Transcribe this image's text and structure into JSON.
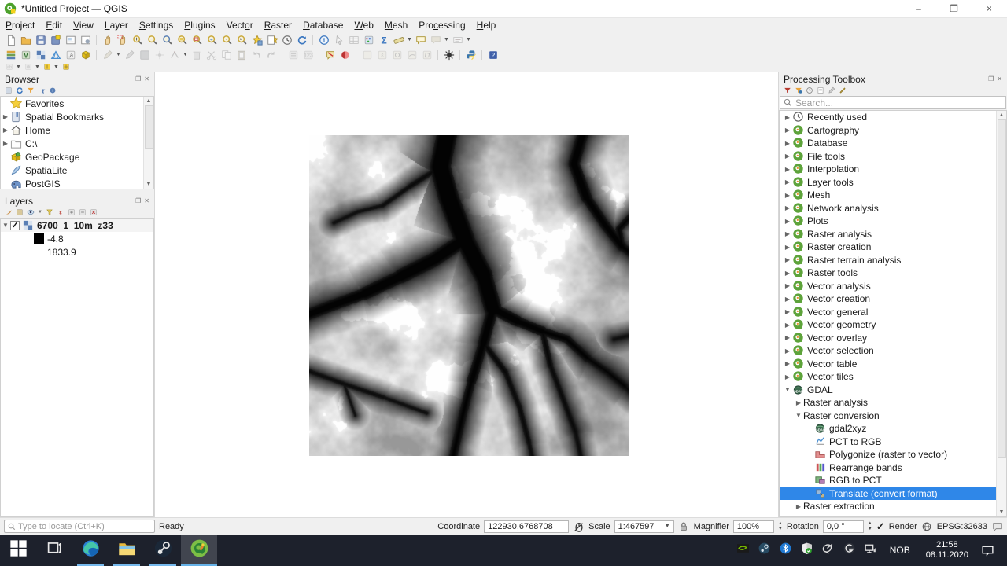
{
  "window": {
    "title": "*Untitled Project — QGIS",
    "minimize": "–",
    "restore": "❐",
    "close": "×"
  },
  "menu": {
    "items": [
      {
        "label": "Project",
        "u": 0
      },
      {
        "label": "Edit",
        "u": 0
      },
      {
        "label": "View",
        "u": 0
      },
      {
        "label": "Layer",
        "u": 0
      },
      {
        "label": "Settings",
        "u": 0
      },
      {
        "label": "Plugins",
        "u": 0
      },
      {
        "label": "Vector",
        "u": 4
      },
      {
        "label": "Raster",
        "u": 0
      },
      {
        "label": "Database",
        "u": 0
      },
      {
        "label": "Web",
        "u": 0
      },
      {
        "label": "Mesh",
        "u": 0
      },
      {
        "label": "Processing",
        "u": 3
      },
      {
        "label": "Help",
        "u": 0
      }
    ]
  },
  "toolbars": {
    "row1": [
      {
        "n": "new-project",
        "k": "doc"
      },
      {
        "n": "open-project",
        "k": "folder"
      },
      {
        "n": "save-project",
        "k": "disk"
      },
      {
        "n": "save-project-as",
        "k": "disklock"
      },
      {
        "n": "new-print-layout",
        "k": "layout"
      },
      {
        "n": "layout-manager",
        "k": "layoutmgr"
      },
      {
        "sep": true
      },
      {
        "n": "pan-map",
        "k": "hand"
      },
      {
        "n": "pan-to-selection",
        "k": "handsel"
      },
      {
        "n": "zoom-in",
        "k": "mag",
        "t": "+"
      },
      {
        "n": "zoom-out",
        "k": "mag",
        "t": "−"
      },
      {
        "n": "zoom-native",
        "k": "magblue"
      },
      {
        "n": "zoom-full",
        "k": "magfull"
      },
      {
        "n": "zoom-to-selection",
        "k": "magsel"
      },
      {
        "n": "zoom-to-layer",
        "k": "maglayer"
      },
      {
        "n": "zoom-last",
        "k": "magback"
      },
      {
        "n": "zoom-next",
        "k": "magfwd"
      },
      {
        "n": "new-bookmark",
        "k": "bookstar"
      },
      {
        "n": "show-bookmarks",
        "k": "bookshow"
      },
      {
        "n": "temporal-controller",
        "k": "clock"
      },
      {
        "n": "refresh-map",
        "k": "refresh"
      },
      {
        "sep": true
      },
      {
        "n": "identify-features",
        "k": "identify"
      },
      {
        "n": "select-features",
        "k": "cursorsel",
        "dis": true
      },
      {
        "n": "open-attribute-table",
        "k": "table",
        "dis": true
      },
      {
        "n": "field-calculator",
        "k": "abacus"
      },
      {
        "n": "statistical-summary",
        "k": "sigma"
      },
      {
        "n": "measure",
        "k": "ruler"
      },
      {
        "n": "measure-caret",
        "k": "caret"
      },
      {
        "n": "map-tips",
        "k": "bubble"
      },
      {
        "n": "new-annotation",
        "k": "bubbleyellow",
        "dis": true
      },
      {
        "n": "annotation-caret",
        "k": "caret"
      },
      {
        "n": "decorations",
        "k": "titlebox",
        "dis": true
      },
      {
        "n": "decorations-caret",
        "k": "caret"
      }
    ],
    "row2": [
      {
        "n": "data-source-manager",
        "k": "dsm"
      },
      {
        "n": "add-vector-layer",
        "k": "addvector"
      },
      {
        "n": "add-raster-layer",
        "k": "addraster"
      },
      {
        "n": "add-mesh-layer",
        "k": "addmesh"
      },
      {
        "n": "add-delimited-text",
        "k": "adddelim"
      },
      {
        "n": "new-geopackage-layer",
        "k": "newgpkg"
      },
      {
        "sep": true
      },
      {
        "n": "current-edits",
        "k": "editpen",
        "dis": true
      },
      {
        "n": "edits-caret",
        "k": "caret"
      },
      {
        "n": "toggle-editing",
        "k": "pencil",
        "dis": true
      },
      {
        "n": "save-layer-edits",
        "k": "diskedit",
        "dis": true
      },
      {
        "n": "add-feature",
        "k": "nodeadd",
        "dis": true
      },
      {
        "n": "vertex-tool",
        "k": "nodetool",
        "dis": true
      },
      {
        "n": "vertex-caret",
        "k": "caret"
      },
      {
        "n": "delete-selected",
        "k": "trash",
        "dis": true
      },
      {
        "n": "cut-features",
        "k": "scissors",
        "dis": true
      },
      {
        "n": "copy-features",
        "k": "copy",
        "dis": true
      },
      {
        "n": "paste-features",
        "k": "paste",
        "dis": true
      },
      {
        "n": "undo",
        "k": "undo",
        "dis": true
      },
      {
        "n": "redo",
        "k": "redo",
        "dis": true
      },
      {
        "sep": true
      },
      {
        "n": "select-by-form",
        "k": "formsel",
        "dis": true
      },
      {
        "n": "select-by-value",
        "k": "formsel2",
        "dis": true
      },
      {
        "sep": true
      },
      {
        "n": "deselect-all",
        "k": "deselect"
      },
      {
        "n": "invert-selection",
        "k": "invertsel"
      },
      {
        "sep": true
      },
      {
        "n": "select-all",
        "k": "selall",
        "dis": true
      },
      {
        "n": "select-by-expression",
        "k": "selexp",
        "dis": true
      },
      {
        "n": "select-by-radius",
        "k": "selrad",
        "dis": true
      },
      {
        "n": "select-freehand",
        "k": "selfree",
        "dis": true
      },
      {
        "n": "select-polygon",
        "k": "selpoly",
        "dis": true
      },
      {
        "sep": true
      },
      {
        "n": "processing-toolbox",
        "k": "spider"
      },
      {
        "sep": true
      },
      {
        "n": "python-console",
        "k": "python"
      },
      {
        "sep": true
      },
      {
        "n": "help-contents",
        "k": "helpsq"
      }
    ],
    "row3": [
      {
        "n": "layer-labeling-options",
        "k": "lblopts",
        "dis": true
      },
      {
        "n": "labeling-caret",
        "k": "caret"
      },
      {
        "n": "layer-diagram-options",
        "k": "diagopts",
        "dis": true
      },
      {
        "n": "diagram-caret",
        "k": "caret"
      },
      {
        "n": "highlight-pinned-labels",
        "k": "lblpin"
      },
      {
        "n": "pin-caret",
        "k": "caret"
      },
      {
        "n": "move-label",
        "k": "lblmove"
      }
    ]
  },
  "browser": {
    "title": "Browser",
    "tools": [
      "collapse-all",
      "refresh-browser",
      "filter-browser",
      "add-favorite",
      "browser-properties"
    ],
    "items": [
      {
        "label": "Favorites",
        "icon": "star",
        "arrow": ""
      },
      {
        "label": "Spatial Bookmarks",
        "icon": "bookmark",
        "arrow": "right"
      },
      {
        "label": "Home",
        "icon": "home",
        "arrow": "right"
      },
      {
        "label": "C:\\",
        "icon": "folderitem",
        "arrow": "right"
      },
      {
        "label": "GeoPackage",
        "icon": "geopackage",
        "arrow": ""
      },
      {
        "label": "SpatiaLite",
        "icon": "feather",
        "arrow": ""
      },
      {
        "label": "PostGIS",
        "icon": "elephant",
        "arrow": ""
      }
    ]
  },
  "layers": {
    "title": "Layers",
    "tools": [
      "open-layer-styling",
      "add-group",
      "manage-themes",
      "themes-caret",
      "filter-legend",
      "filter-expression",
      "expand-all",
      "collapse-all2",
      "remove-layer"
    ],
    "layer": {
      "name": "6700_1_10m_z33",
      "checked": true,
      "min": "-4.8",
      "max": "1833.9"
    }
  },
  "processing": {
    "title": "Processing Toolbox",
    "tools": [
      "models-menu",
      "scripts-menu",
      "history",
      "results-viewer",
      "edit-in-place",
      "options-tool"
    ],
    "search_placeholder": "Search...",
    "items": [
      {
        "label": "Recently used",
        "icon": "clock2",
        "arrow": "right",
        "level": 0
      },
      {
        "label": "Cartography",
        "icon": "qgis",
        "arrow": "right",
        "level": 0
      },
      {
        "label": "Database",
        "icon": "qgis",
        "arrow": "right",
        "level": 0
      },
      {
        "label": "File tools",
        "icon": "qgis",
        "arrow": "right",
        "level": 0
      },
      {
        "label": "Interpolation",
        "icon": "qgis",
        "arrow": "right",
        "level": 0
      },
      {
        "label": "Layer tools",
        "icon": "qgis",
        "arrow": "right",
        "level": 0
      },
      {
        "label": "Mesh",
        "icon": "qgis",
        "arrow": "right",
        "level": 0
      },
      {
        "label": "Network analysis",
        "icon": "qgis",
        "arrow": "right",
        "level": 0
      },
      {
        "label": "Plots",
        "icon": "qgis",
        "arrow": "right",
        "level": 0
      },
      {
        "label": "Raster analysis",
        "icon": "qgis",
        "arrow": "right",
        "level": 0
      },
      {
        "label": "Raster creation",
        "icon": "qgis",
        "arrow": "right",
        "level": 0
      },
      {
        "label": "Raster terrain analysis",
        "icon": "qgis",
        "arrow": "right",
        "level": 0
      },
      {
        "label": "Raster tools",
        "icon": "qgis",
        "arrow": "right",
        "level": 0
      },
      {
        "label": "Vector analysis",
        "icon": "qgis",
        "arrow": "right",
        "level": 0
      },
      {
        "label": "Vector creation",
        "icon": "qgis",
        "arrow": "right",
        "level": 0
      },
      {
        "label": "Vector general",
        "icon": "qgis",
        "arrow": "right",
        "level": 0
      },
      {
        "label": "Vector geometry",
        "icon": "qgis",
        "arrow": "right",
        "level": 0
      },
      {
        "label": "Vector overlay",
        "icon": "qgis",
        "arrow": "right",
        "level": 0
      },
      {
        "label": "Vector selection",
        "icon": "qgis",
        "arrow": "right",
        "level": 0
      },
      {
        "label": "Vector table",
        "icon": "qgis",
        "arrow": "right",
        "level": 0
      },
      {
        "label": "Vector tiles",
        "icon": "qgis",
        "arrow": "right",
        "level": 0
      },
      {
        "label": "GDAL",
        "icon": "gdal",
        "arrow": "down",
        "level": 0
      },
      {
        "label": "Raster analysis",
        "icon": "",
        "arrow": "right",
        "level": 1
      },
      {
        "label": "Raster conversion",
        "icon": "",
        "arrow": "down",
        "level": 1
      },
      {
        "label": "gdal2xyz",
        "icon": "gdal",
        "arrow": "",
        "level": 2
      },
      {
        "label": "PCT to RGB",
        "icon": "toolpct",
        "arrow": "",
        "level": 2
      },
      {
        "label": "Polygonize (raster to vector)",
        "icon": "toolpoly",
        "arrow": "",
        "level": 2
      },
      {
        "label": "Rearrange bands",
        "icon": "toolbands",
        "arrow": "",
        "level": 2
      },
      {
        "label": "RGB to PCT",
        "icon": "toolrgb",
        "arrow": "",
        "level": 2
      },
      {
        "label": "Translate (convert format)",
        "icon": "tooltrans",
        "arrow": "",
        "level": 2,
        "selected": true
      },
      {
        "label": "Raster extraction",
        "icon": "",
        "arrow": "right",
        "level": 1
      }
    ]
  },
  "map_canvas": {
    "content": "grayscale DEM raster"
  },
  "statusbar": {
    "locate_placeholder": "Type to locate (Ctrl+K)",
    "ready": "Ready",
    "coordinate_label": "Coordinate",
    "coordinate_value": "122930,6768708",
    "scale_label": "Scale",
    "scale_value": "1:467597",
    "magnifier_label": "Magnifier",
    "magnifier_value": "100%",
    "rotation_label": "Rotation",
    "rotation_value": "0,0 °",
    "render_label": "Render",
    "render_checked": "✓",
    "epsg": "EPSG:32633"
  },
  "taskbar": {
    "apps": [
      {
        "n": "start",
        "k": "win",
        "cls": ""
      },
      {
        "n": "task-view",
        "k": "taskview",
        "cls": "small"
      },
      {
        "n": "edge",
        "k": "edge",
        "cls": "running"
      },
      {
        "n": "file-explorer",
        "k": "explorer",
        "cls": "running"
      },
      {
        "n": "steam",
        "k": "steamapp",
        "cls": "running"
      },
      {
        "n": "qgis-app",
        "k": "qgisapp",
        "cls": "running active"
      }
    ],
    "tray": [
      "nvidia",
      "steamtray",
      "bluetooth",
      "defender",
      "dish",
      "logitech",
      "network"
    ],
    "lang": "NOB",
    "time": "21:58",
    "date": "08.11.2020"
  },
  "colors": {
    "selection": "#2f87e8",
    "taskbar": "#1d212c",
    "underline": "#76b9ed"
  }
}
